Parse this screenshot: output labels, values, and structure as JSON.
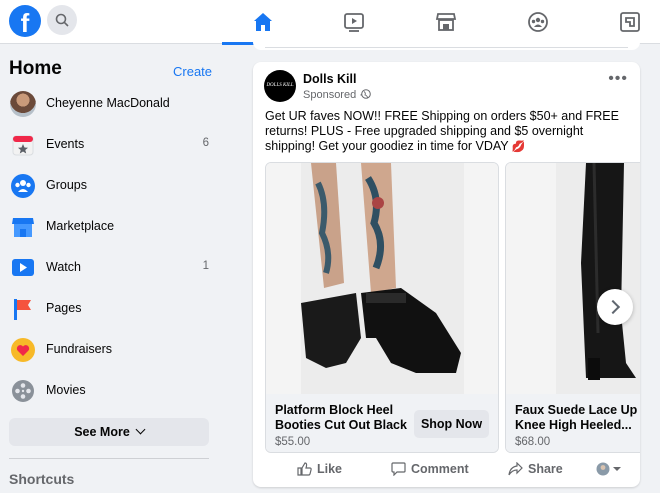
{
  "colors": {
    "brand": "#1877f2",
    "background": "#f0f2f5",
    "secondary_text": "#65676b"
  },
  "topbar": {
    "logo_letter": "f",
    "nav": [
      {
        "name": "home",
        "icon": "home-icon",
        "active": true
      },
      {
        "name": "watch",
        "icon": "video-icon",
        "active": false
      },
      {
        "name": "marketplace",
        "icon": "store-icon",
        "active": false
      },
      {
        "name": "groups",
        "icon": "groups-icon",
        "active": false
      },
      {
        "name": "gaming",
        "icon": "gaming-icon",
        "active": false
      }
    ]
  },
  "sidebar": {
    "title": "Home",
    "create_label": "Create",
    "items": [
      {
        "label": "Cheyenne MacDonald",
        "icon": "avatar",
        "count": ""
      },
      {
        "label": "Events",
        "icon": "calendar-icon",
        "count": "6"
      },
      {
        "label": "Groups",
        "icon": "groups-icon",
        "count": ""
      },
      {
        "label": "Marketplace",
        "icon": "store-icon",
        "count": ""
      },
      {
        "label": "Watch",
        "icon": "video-icon",
        "count": "1"
      },
      {
        "label": "Pages",
        "icon": "flag-icon",
        "count": ""
      },
      {
        "label": "Fundraisers",
        "icon": "heart-icon",
        "count": ""
      },
      {
        "label": "Movies",
        "icon": "film-reel-icon",
        "count": ""
      }
    ],
    "see_more_label": "See More",
    "shortcuts_label": "Shortcuts"
  },
  "post": {
    "page_name": "Dolls Kill",
    "page_avatar_text": "DOLLS KILL",
    "sponsored_label": "Sponsored ·",
    "text": "Get UR faves NOW!! FREE Shipping on orders $50+ and FREE returns! PLUS - Free upgraded shipping and $5 overnight shipping! Get your goodiez in time for VDAY",
    "emoji": "💋",
    "products": [
      {
        "title": "Platform Block Heel Booties Cut Out Black",
        "price": "$55.00",
        "button": "Shop Now"
      },
      {
        "title": "Faux Suede Lace Up Knee High Heeled...",
        "price": "$68.00",
        "button": ""
      }
    ],
    "actions": {
      "like": "Like",
      "comment": "Comment",
      "share": "Share"
    }
  }
}
